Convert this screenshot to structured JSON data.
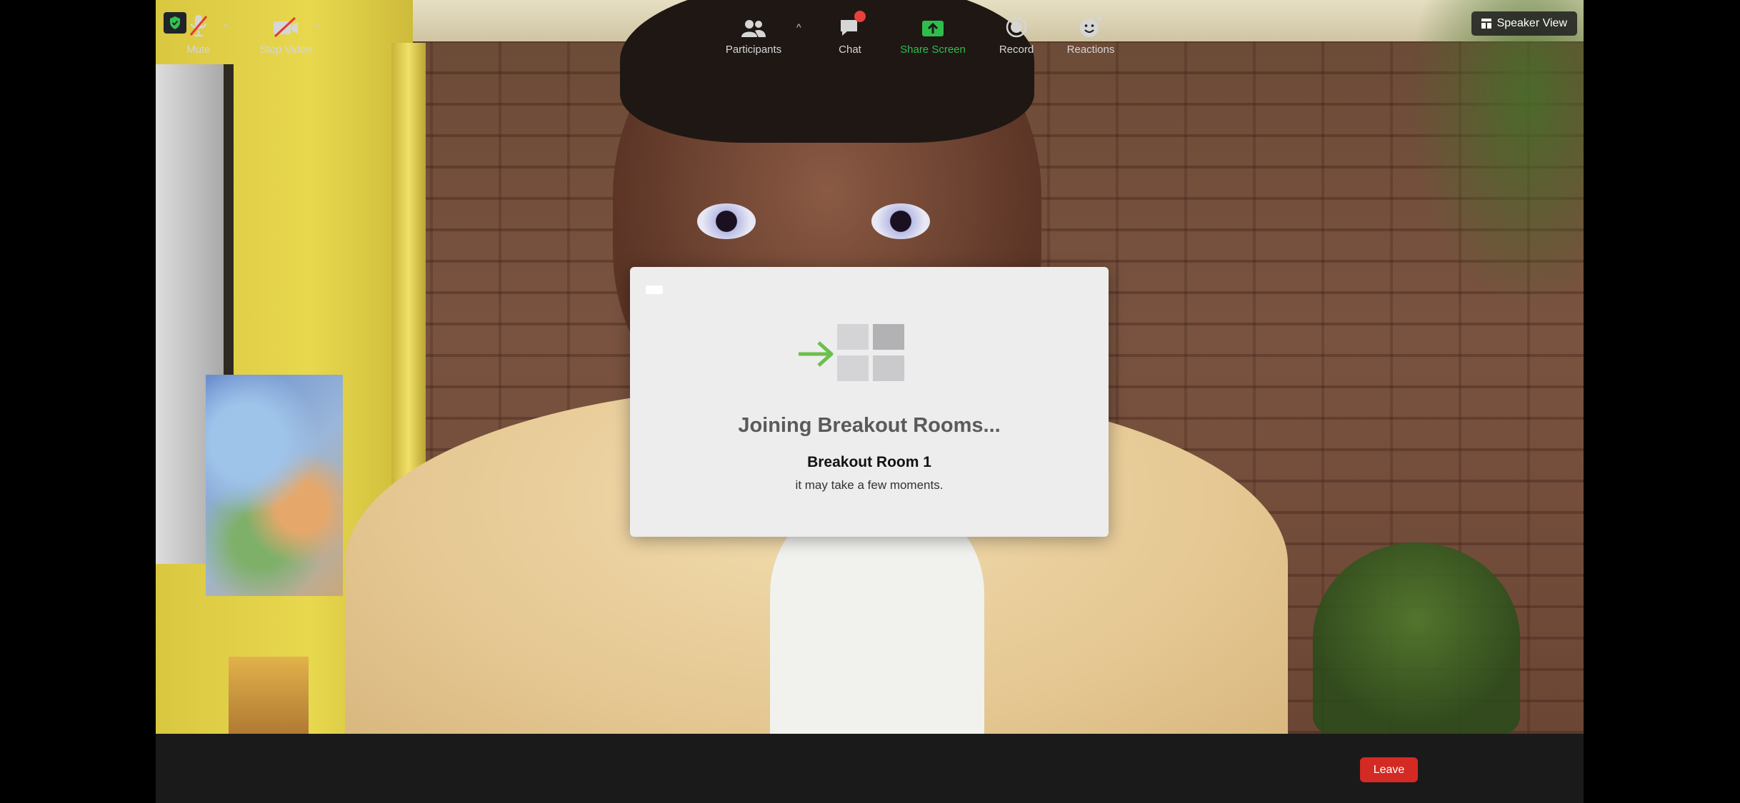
{
  "header": {
    "security_icon": "shield-check-icon",
    "speaker_view_label": "Speaker View"
  },
  "modal": {
    "title": "Joining Breakout Rooms...",
    "room": "Breakout Room 1",
    "subtitle": "it may take a few moments."
  },
  "toolbar": {
    "mute_label": "Mute",
    "stop_video_label": "Stop Video",
    "participants_label": "Participants",
    "chat_label": "Chat",
    "share_screen_label": "Share Screen",
    "record_label": "Record",
    "reactions_label": "Reactions",
    "leave_label": "Leave"
  },
  "colors": {
    "toolbar_bg": "#1a1a1a",
    "share_green": "#2ebd4d",
    "leave_red": "#d32a23",
    "chat_badge": "#e8413a",
    "arrow_green": "#6dbf4b"
  }
}
